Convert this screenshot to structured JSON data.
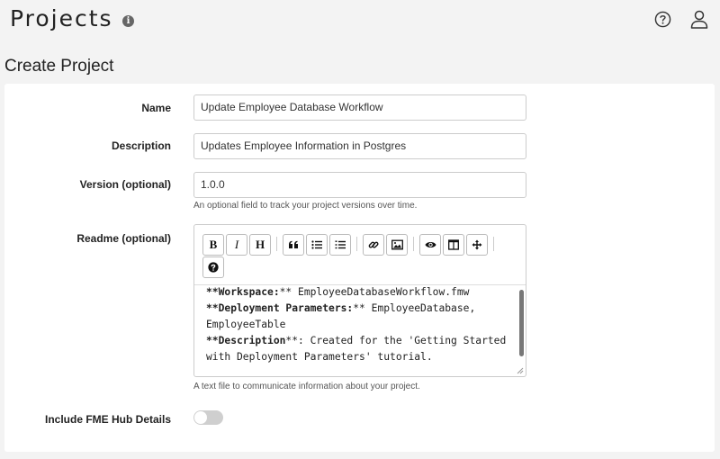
{
  "header": {
    "title": "Projects",
    "info_icon": "info-icon",
    "help_icon": "help-circle-icon",
    "user_icon": "user-icon"
  },
  "page": {
    "heading": "Create Project"
  },
  "form": {
    "name": {
      "label": "Name",
      "value": "Update Employee Database Workflow"
    },
    "description": {
      "label": "Description",
      "value": "Updates Employee Information in Postgres"
    },
    "version": {
      "label": "Version (optional)",
      "value": "1.0.0",
      "help": "An optional field to track your project versions over time."
    },
    "readme": {
      "label": "Readme (optional)",
      "help": "A text file to communicate information about your project.",
      "toolbar": {
        "bold": "B",
        "italic": "I",
        "heading": "H",
        "quote": "quote-icon",
        "unordered_list": "bullet-list-icon",
        "ordered_list": "numbered-list-icon",
        "link": "link-icon",
        "image": "image-icon",
        "preview": "eye-icon",
        "side_by_side": "columns-icon",
        "fullscreen": "arrows-icon",
        "guide": "question-icon"
      },
      "lines": [
        {
          "bold": "**Workspace:",
          "rest": "** EmployeeDatabaseWorkflow.fmw"
        },
        {
          "bold": "**Deployment Parameters:",
          "rest": "** EmployeeDatabase,"
        },
        {
          "bold": "",
          "rest": "EmployeeTable"
        },
        {
          "bold": "**Description",
          "rest": "**: Created for the 'Getting Started"
        },
        {
          "bold": "",
          "rest": "with Deployment Parameters' tutorial."
        }
      ]
    },
    "hub_details": {
      "label": "Include FME Hub Details",
      "enabled": false
    }
  },
  "colors": {
    "background": "#f3f3f3",
    "card": "#ffffff",
    "toggle_off": "#cfcfcf"
  }
}
